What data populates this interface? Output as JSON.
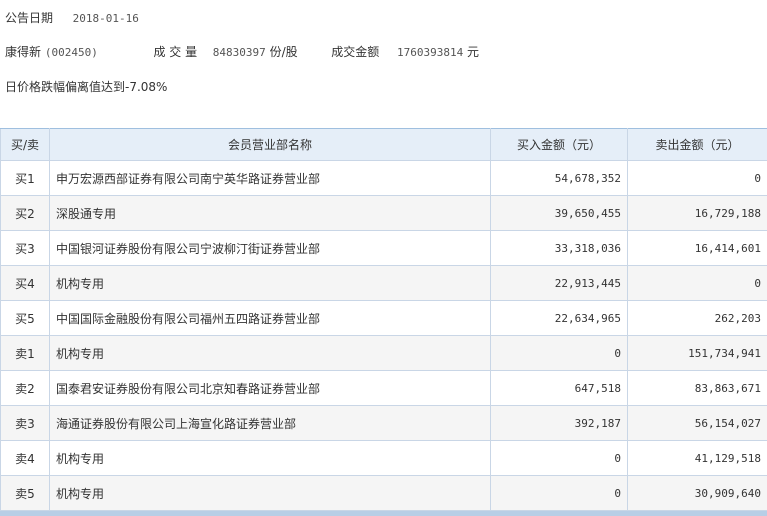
{
  "header": {
    "date_label": "公告日期",
    "date_value": "2018-01-16",
    "stock_name": "康得新",
    "stock_code": "(002450)",
    "volume_label": "成 交 量",
    "volume_value": "84830397",
    "volume_unit": "份/股",
    "amount_label": "成交金额",
    "amount_value": "1760393814",
    "amount_unit": "元",
    "reason": "日价格跌幅偏离值达到-7.08%"
  },
  "table": {
    "columns": [
      "买/卖",
      "会员营业部名称",
      "买入金额（元）",
      "卖出金额（元）"
    ],
    "rows": [
      {
        "side": "买1",
        "name": "申万宏源西部证券有限公司南宁英华路证券营业部",
        "buy": "54,678,352",
        "sell": "0"
      },
      {
        "side": "买2",
        "name": "深股通专用",
        "buy": "39,650,455",
        "sell": "16,729,188"
      },
      {
        "side": "买3",
        "name": "中国银河证券股份有限公司宁波柳汀街证券营业部",
        "buy": "33,318,036",
        "sell": "16,414,601"
      },
      {
        "side": "买4",
        "name": "机构专用",
        "buy": "22,913,445",
        "sell": "0"
      },
      {
        "side": "买5",
        "name": "中国国际金融股份有限公司福州五四路证券营业部",
        "buy": "22,634,965",
        "sell": "262,203"
      },
      {
        "side": "卖1",
        "name": "机构专用",
        "buy": "0",
        "sell": "151,734,941"
      },
      {
        "side": "卖2",
        "name": "国泰君安证券股份有限公司北京知春路证券营业部",
        "buy": "647,518",
        "sell": "83,863,671"
      },
      {
        "side": "卖3",
        "name": "海通证券股份有限公司上海宣化路证券营业部",
        "buy": "392,187",
        "sell": "56,154,027"
      },
      {
        "side": "卖4",
        "name": "机构专用",
        "buy": "0",
        "sell": "41,129,518"
      },
      {
        "side": "卖5",
        "name": "机构专用",
        "buy": "0",
        "sell": "30,909,640"
      }
    ]
  }
}
